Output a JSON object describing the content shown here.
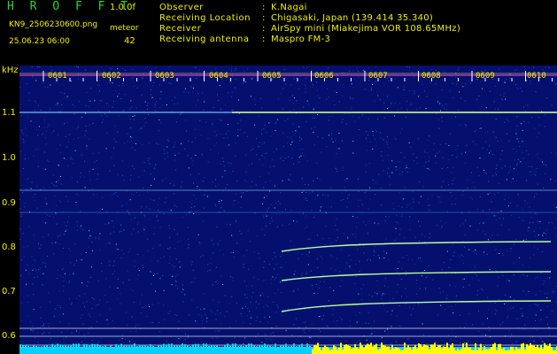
{
  "app": {
    "title": "H R O F F T",
    "version": "1.0.0f",
    "filename": "KN9_2506230600.png",
    "datetime": "25.06.23 06:00",
    "meteor_label": "meteor",
    "meteor_count": "42"
  },
  "info": [
    {
      "label": "Observer",
      "value": "K.Nagai"
    },
    {
      "label": "Receiving Location",
      "value": "Chigasaki, Japan (139.414 35.340)"
    },
    {
      "label": "Receiver",
      "value": "AirSpy mini (Miakejima VOR 108.65MHz)"
    },
    {
      "label": "Receiving antenna",
      "value": "Maspro FM-3"
    }
  ],
  "separator": ":",
  "axis": {
    "unit": "kHz",
    "ticks": [
      "1.1",
      "1.0",
      "0.9",
      "0.8",
      "0.7",
      "0.6"
    ]
  },
  "time_labels": [
    "0601",
    "0602",
    "0603",
    "0604",
    "0605",
    "0606",
    "0607",
    "0608",
    "0609",
    "0610"
  ],
  "colors": {
    "background": "#05106e",
    "text": "#f0f000",
    "title": "#2bd62b",
    "trace": "#b8ffa0",
    "noise": "#00d0ff",
    "burst": "#ffff00"
  }
}
